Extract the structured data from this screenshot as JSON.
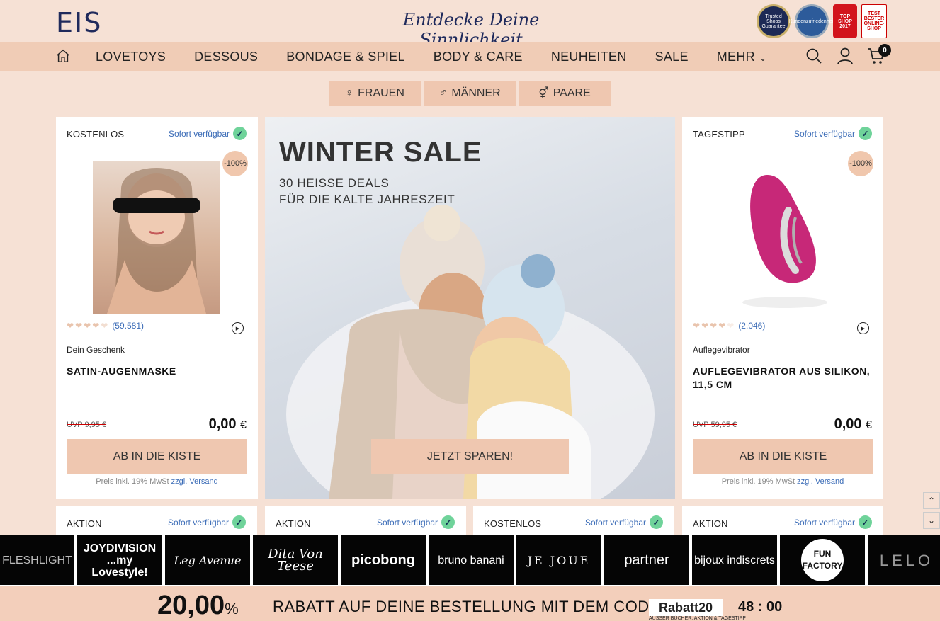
{
  "header": {
    "logo": "EIS",
    "tagline": "Entdecke Deine Sinnlichkeit",
    "badges": [
      "Trusted Shops Guarantee",
      "Kundenzufriedenheit",
      "TOP SHOP 2017",
      "TEST BESTER ONLINE-SHOP"
    ]
  },
  "nav": {
    "items": [
      "LOVETOYS",
      "DESSOUS",
      "BONDAGE & SPIEL",
      "BODY & CARE",
      "NEUHEITEN",
      "SALE",
      "MEHR"
    ],
    "cart_count": "0"
  },
  "gender": {
    "women": "FRAUEN",
    "men": "MÄNNER",
    "couples": "PAARE"
  },
  "cards": [
    {
      "tag": "KOSTENLOS",
      "availability": "Sofort verfügbar",
      "discount": "-100%",
      "rating_count": "(59.581)",
      "category": "Dein Geschenk",
      "name": "SATIN-AUGENMASKE",
      "uvp": "UVP 9,95 €",
      "price": "0,00",
      "currency": "€",
      "button": "AB IN DIE KISTE",
      "note_prefix": "Preis inkl. 19% MwSt",
      "note_zzgl": "zzgl.",
      "note_link": "Versand",
      "rating": 4.5
    },
    {
      "tag": "TAGESTIPP",
      "availability": "Sofort verfügbar",
      "discount": "-100%",
      "rating_count": "(2.046)",
      "category": "Auflegevibrator",
      "name": "AUFLEGEVIBRATOR AUS SILIKON, 11,5 CM",
      "uvp": "UVP 59,95 €",
      "price": "0,00",
      "currency": "€",
      "button": "AB IN DIE KISTE",
      "note_prefix": "Preis inkl. 19% MwSt",
      "note_zzgl": "zzgl.",
      "note_link": "Versand",
      "rating": 4
    }
  ],
  "hero": {
    "title": "WINTER SALE",
    "sub1": "30 HEISSE DEALS",
    "sub2": "FÜR DIE KALTE JAHRESZEIT",
    "button": "JETZT SPAREN!"
  },
  "row2": [
    {
      "tag": "AKTION",
      "availability": "Sofort verfügbar"
    },
    {
      "tag": "AKTION",
      "availability": "Sofort verfügbar"
    },
    {
      "tag": "KOSTENLOS",
      "availability": "Sofort verfügbar"
    },
    {
      "tag": "AKTION",
      "availability": "Sofort verfügbar"
    }
  ],
  "brands": [
    "FLESHLIGHT",
    "JOYDIVISION ...my Lovestyle!",
    "Leg Avenue",
    "Dita Von Teese",
    "picobong",
    "bruno banani",
    "JE JOUE",
    "partner",
    "bijoux indiscrets",
    "FUN FACTORY",
    "LELO"
  ],
  "promo": {
    "amount": "20,00",
    "percent": "%",
    "text": "RABATT AUF DEINE BESTELLUNG MIT DEM CODE",
    "code": "Rabatt20",
    "small": "AUSSER BÜCHER, AKTION & TAGESTIPP",
    "timer": "48 : 00"
  },
  "colors": {
    "bg": "#f6e1d5",
    "nav": "#f0ccb6",
    "accent": "#efc7b0",
    "link": "#3b6cb7",
    "logo": "#1f2a5c"
  }
}
